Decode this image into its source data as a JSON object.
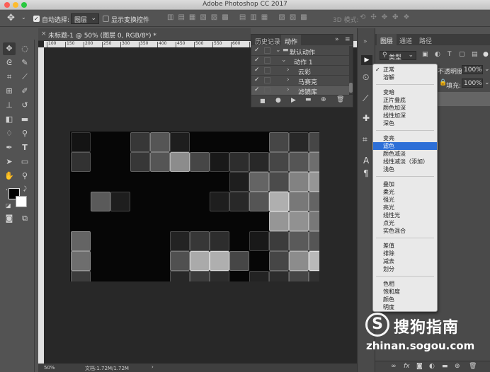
{
  "window": {
    "title": "Adobe Photoshop CC 2017"
  },
  "options_bar": {
    "auto_select_label": "自动选择:",
    "auto_select_value": "图层",
    "show_transform_label": "显示变换控件",
    "mode_3d_label": "3D 模式:"
  },
  "document": {
    "tab_title": "未标题-1 @ 50% (图层 0, RGB/8*) *",
    "ruler_ticks": [
      "100",
      "150",
      "200",
      "250",
      "300",
      "350",
      "400",
      "450",
      "500",
      "550",
      "600",
      "650",
      "700",
      "750",
      "800",
      "850",
      "900"
    ],
    "zoom": "50%",
    "doc_info": "文档:1.72M/1.72M"
  },
  "actions_panel": {
    "tabs": [
      "历史记录",
      "动作"
    ],
    "active_tab": "动作",
    "rows": [
      {
        "label": "默认动作",
        "indent": 0
      },
      {
        "label": "动作 1",
        "indent": 1
      },
      {
        "label": "云彩",
        "indent": 2
      },
      {
        "label": "马赛克",
        "indent": 2
      },
      {
        "label": "滤镜库",
        "indent": 2
      }
    ]
  },
  "layers_panel": {
    "tabs": [
      "图层",
      "通道",
      "路径"
    ],
    "filter_label": "类型",
    "opacity_label": "不透明度:",
    "opacity_value": "100%",
    "fill_label": "填充:",
    "fill_value": "100%"
  },
  "blend_menu": {
    "selected": "滤色",
    "groups": [
      [
        "正常",
        "溶解"
      ],
      [
        "变暗",
        "正片叠底",
        "颜色加深",
        "线性加深",
        "深色"
      ],
      [
        "变亮",
        "滤色",
        "颜色减淡",
        "线性减淡（添加）",
        "浅色"
      ],
      [
        "叠加",
        "柔光",
        "强光",
        "亮光",
        "线性光",
        "点光",
        "实色混合"
      ],
      [
        "差值",
        "排除",
        "减去",
        "划分"
      ],
      [
        "色相",
        "饱和度",
        "颜色",
        "明度"
      ]
    ],
    "checked": "正常"
  },
  "watermark": {
    "logo_glyph": "S",
    "brand": "搜狗指南",
    "url": "zhinan.sogou.com"
  },
  "mosaic_tiles": [
    {
      "c": 0,
      "r": 0,
      "v": 20
    },
    {
      "c": 3,
      "r": 0,
      "v": 55
    },
    {
      "c": 4,
      "r": 0,
      "v": 85
    },
    {
      "c": 5,
      "r": 0,
      "v": 30
    },
    {
      "c": 10,
      "r": 0,
      "v": 70
    },
    {
      "c": 11,
      "r": 0,
      "v": 40
    },
    {
      "c": 12,
      "r": 0,
      "v": 70
    },
    {
      "c": 0,
      "r": 1,
      "v": 50
    },
    {
      "c": 3,
      "r": 1,
      "v": 55
    },
    {
      "c": 4,
      "r": 1,
      "v": 85
    },
    {
      "c": 5,
      "r": 1,
      "v": 140
    },
    {
      "c": 6,
      "r": 1,
      "v": 70
    },
    {
      "c": 7,
      "r": 1,
      "v": 25
    },
    {
      "c": 8,
      "r": 1,
      "v": 45
    },
    {
      "c": 9,
      "r": 1,
      "v": 40
    },
    {
      "c": 10,
      "r": 1,
      "v": 70
    },
    {
      "c": 11,
      "r": 1,
      "v": 85
    },
    {
      "c": 12,
      "r": 1,
      "v": 110
    },
    {
      "c": 8,
      "r": 2,
      "v": 30
    },
    {
      "c": 9,
      "r": 2,
      "v": 100
    },
    {
      "c": 10,
      "r": 2,
      "v": 75
    },
    {
      "c": 11,
      "r": 2,
      "v": 130
    },
    {
      "c": 12,
      "r": 2,
      "v": 150
    },
    {
      "c": 1,
      "r": 3,
      "v": 90
    },
    {
      "c": 2,
      "r": 3,
      "v": 30
    },
    {
      "c": 7,
      "r": 3,
      "v": 30
    },
    {
      "c": 8,
      "r": 3,
      "v": 40
    },
    {
      "c": 9,
      "r": 3,
      "v": 85
    },
    {
      "c": 10,
      "r": 3,
      "v": 175
    },
    {
      "c": 11,
      "r": 3,
      "v": 120
    },
    {
      "c": 12,
      "r": 3,
      "v": 100
    },
    {
      "c": 10,
      "r": 4,
      "v": 150
    },
    {
      "c": 11,
      "r": 4,
      "v": 145
    },
    {
      "c": 12,
      "r": 4,
      "v": 120
    },
    {
      "c": 0,
      "r": 5,
      "v": 100
    },
    {
      "c": 5,
      "r": 5,
      "v": 35
    },
    {
      "c": 6,
      "r": 5,
      "v": 55
    },
    {
      "c": 7,
      "r": 5,
      "v": 45
    },
    {
      "c": 9,
      "r": 5,
      "v": 25
    },
    {
      "c": 10,
      "r": 5,
      "v": 60
    },
    {
      "c": 11,
      "r": 5,
      "v": 90
    },
    {
      "c": 12,
      "r": 5,
      "v": 85
    },
    {
      "c": 0,
      "r": 6,
      "v": 110
    },
    {
      "c": 5,
      "r": 6,
      "v": 80
    },
    {
      "c": 6,
      "r": 6,
      "v": 170
    },
    {
      "c": 7,
      "r": 6,
      "v": 175
    },
    {
      "c": 8,
      "r": 6,
      "v": 70
    },
    {
      "c": 10,
      "r": 6,
      "v": 70
    },
    {
      "c": 11,
      "r": 6,
      "v": 140
    },
    {
      "c": 12,
      "r": 6,
      "v": 185
    },
    {
      "c": 0,
      "r": 7,
      "v": 60
    },
    {
      "c": 5,
      "r": 7,
      "v": 40
    },
    {
      "c": 6,
      "r": 7,
      "v": 60
    },
    {
      "c": 7,
      "r": 7,
      "v": 45
    },
    {
      "c": 9,
      "r": 7,
      "v": 35
    },
    {
      "c": 10,
      "r": 7,
      "v": 45
    },
    {
      "c": 11,
      "r": 7,
      "v": 70
    },
    {
      "c": 12,
      "r": 7,
      "v": 50
    }
  ]
}
